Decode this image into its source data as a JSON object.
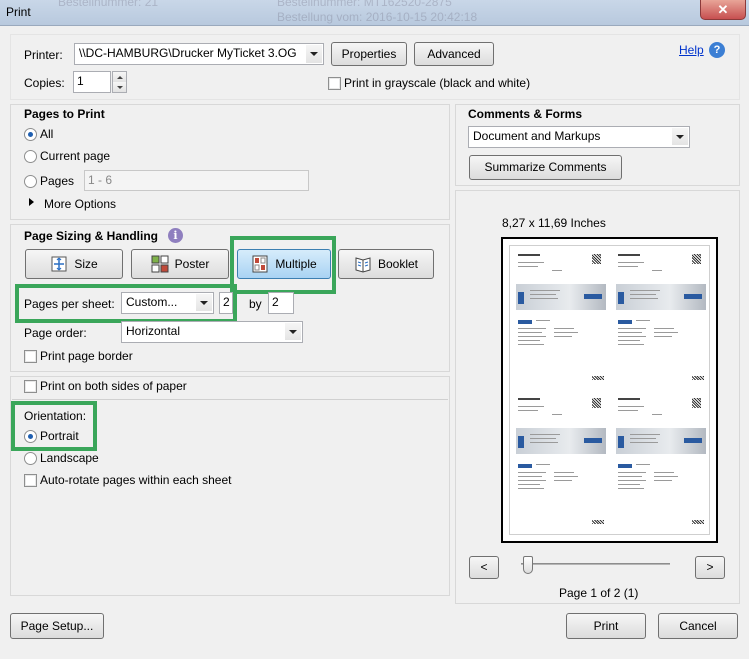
{
  "window": {
    "title": "Print",
    "close_label": "✕",
    "background_ghost_lines": [
      "Bestellnummer: 21",
      "Bestellnummer: MT162520-2875",
      "Bestellung vom: 2016-10-15 20:42:18"
    ]
  },
  "printer": {
    "label": "Printer:",
    "value": "\\\\DC-HAMBURG\\Drucker MyTicket 3.OG",
    "properties_label": "Properties",
    "advanced_label": "Advanced",
    "help_label": "Help",
    "copies_label": "Copies:",
    "copies_value": "1",
    "grayscale_label": "Print in grayscale (black and white)"
  },
  "pages_to_print": {
    "title": "Pages to Print",
    "all_label": "All",
    "current_label": "Current page",
    "pages_label": "Pages",
    "pages_value": "1 - 6",
    "more_options_label": "More Options"
  },
  "sizing": {
    "title": "Page Sizing & Handling",
    "size_label": "Size",
    "poster_label": "Poster",
    "multiple_label": "Multiple",
    "booklet_label": "Booklet",
    "pages_per_sheet_label": "Pages per sheet:",
    "pages_per_sheet_value": "Custom...",
    "cols_value": "2",
    "by_label": "by",
    "rows_value": "2",
    "page_order_label": "Page order:",
    "page_order_value": "Horizontal",
    "border_label": "Print page border"
  },
  "duplex": {
    "both_sides_label": "Print on both sides of paper"
  },
  "orientation": {
    "label": "Orientation:",
    "portrait_label": "Portrait",
    "landscape_label": "Landscape",
    "autorotate_label": "Auto-rotate pages within each sheet"
  },
  "comments": {
    "title": "Comments & Forms",
    "value": "Document and Markups",
    "summarize_label": "Summarize Comments"
  },
  "preview": {
    "size_text": "8,27 x 11,69 Inches",
    "prev_label": "<",
    "next_label": ">",
    "page_text": "Page 1 of 2 (1)"
  },
  "footer": {
    "page_setup_label": "Page Setup...",
    "print_label": "Print",
    "cancel_label": "Cancel"
  },
  "colors": {
    "highlight": "#3aa65a",
    "active_button": "#a9d3f3"
  }
}
